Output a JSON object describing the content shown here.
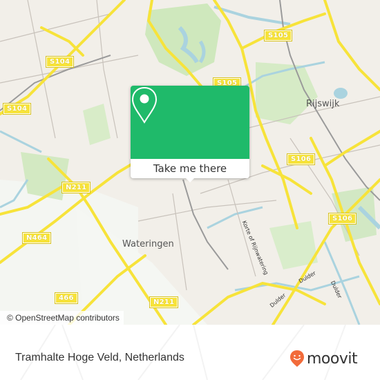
{
  "map": {
    "attribution": "© OpenStreetMap contributors",
    "places": [
      {
        "name": "Rijswijk"
      },
      {
        "name": "Wateringen"
      }
    ],
    "road_shields": [
      {
        "label": "S104"
      },
      {
        "label": "S104"
      },
      {
        "label": "S105"
      },
      {
        "label": "S105"
      },
      {
        "label": "S106"
      },
      {
        "label": "S106"
      },
      {
        "label": "N211"
      },
      {
        "label": "N211"
      },
      {
        "label": "N464"
      },
      {
        "label": "466"
      }
    ],
    "streets": [
      {
        "name": "Korte of Rijnwatering"
      },
      {
        "name": "Dulder"
      },
      {
        "name": "Dulder"
      },
      {
        "name": "Dulder"
      }
    ],
    "colors": {
      "background": "#f2efe9",
      "major_road": "#f7e33a",
      "water": "#aad3df",
      "park": "#c8e6b0",
      "rail": "#888888"
    }
  },
  "popup": {
    "icon": "map-pin-icon",
    "button_label": "Take me there",
    "accent_color": "#1fba6a"
  },
  "footer": {
    "location_title": "Tramhalte Hoge Veld, Netherlands",
    "brand": "moovit",
    "brand_color": "#f26b3a"
  }
}
